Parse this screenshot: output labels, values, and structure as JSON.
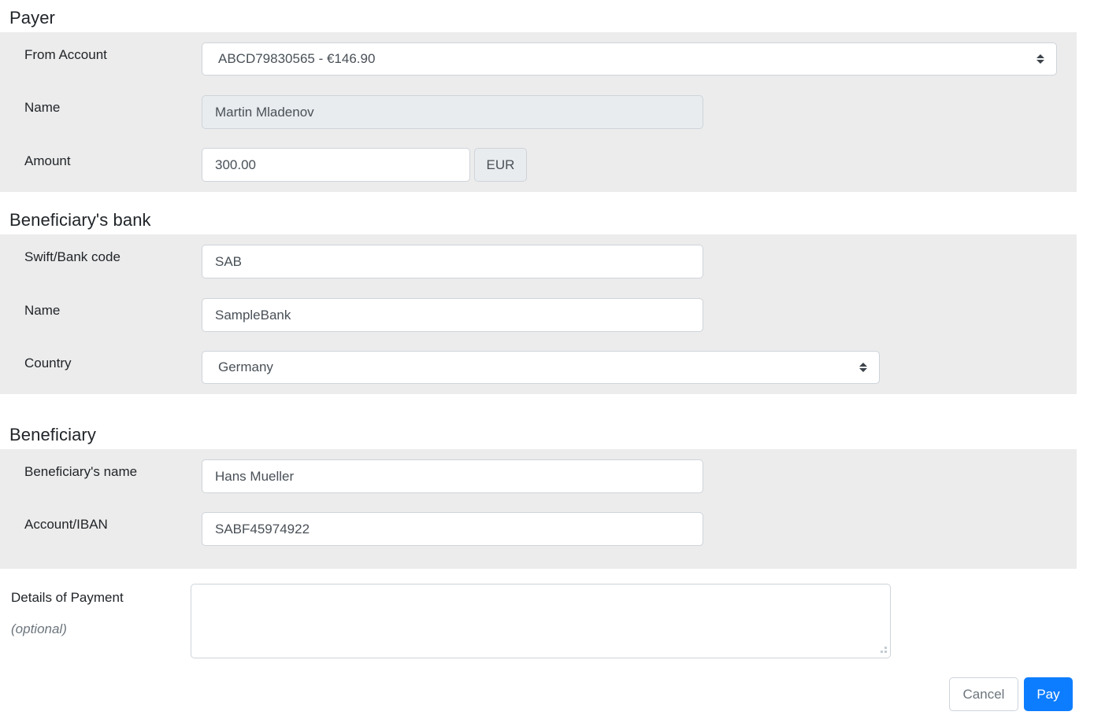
{
  "form": {
    "sections": [
      {
        "id": "payer",
        "heading": "Payer",
        "fields": [
          {
            "id": "from-account",
            "label": "From Account",
            "type": "select",
            "value": "ABCD79830565 - €146.90",
            "options": [
              "ABCD79830565 - €146.90"
            ]
          },
          {
            "id": "payer-name",
            "label": "Name",
            "type": "text",
            "value": "Martin Mladenov",
            "disabled": true
          },
          {
            "id": "amount",
            "label": "Amount",
            "type": "text",
            "value": "300.00",
            "addon": "EUR"
          }
        ]
      },
      {
        "id": "beneficiary-bank",
        "heading": "Beneficiary's bank",
        "fields": [
          {
            "id": "swift-code",
            "label": "Swift/Bank code",
            "type": "text",
            "value": "SAB"
          },
          {
            "id": "bank-name",
            "label": "Name",
            "type": "text",
            "value": "SampleBank"
          },
          {
            "id": "country",
            "label": "Country",
            "type": "select",
            "value": "Germany",
            "options": [
              "Germany"
            ]
          }
        ]
      },
      {
        "id": "beneficiary",
        "heading": "Beneficiary",
        "fields": [
          {
            "id": "beneficiary-name",
            "label": "Beneficiary's name",
            "type": "text",
            "value": "Hans Mueller"
          },
          {
            "id": "account-iban",
            "label": "Account/IBAN",
            "type": "text",
            "value": "SABF45974922"
          }
        ]
      }
    ],
    "details": {
      "label": "Details of Payment",
      "optional_note": "(optional)",
      "value": "",
      "placeholder": ""
    },
    "actions": {
      "cancel_label": "Cancel",
      "pay_label": "Pay"
    }
  },
  "colors": {
    "panel_bg": "#ececec",
    "page_bg": "#ffffff",
    "primary": "#0d7dff",
    "border": "#ced4da",
    "disabled_bg": "#e9ecef",
    "text": "#212529",
    "muted_text": "#6c757d"
  },
  "icons": {
    "select_arrows": "chevron-updown-icon",
    "resize_grip": "resize-grip-icon"
  }
}
